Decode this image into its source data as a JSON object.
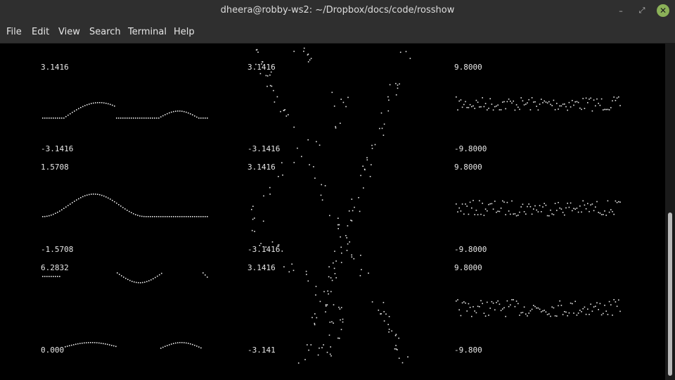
{
  "window": {
    "title": "dheera@robby-ws2: ~/Dropbox/docs/code/rosshow",
    "minimize_glyph": "–",
    "maximize_glyph": "⤢",
    "close_glyph": "✕"
  },
  "menu": [
    "File",
    "Edit",
    "View",
    "Search",
    "Terminal",
    "Help"
  ],
  "plots": [
    {
      "top": "3.1416",
      "bottom": "-3.1416"
    },
    {
      "top": "3.1416",
      "bottom": "-3.1416"
    },
    {
      "top": "9.8000",
      "bottom": "-9.8000"
    },
    {
      "top": "1.5708",
      "bottom": "-1.5708"
    },
    {
      "top": "3.1416",
      "bottom": "-3.1416"
    },
    {
      "top": "9.8000",
      "bottom": "-9.8000"
    },
    {
      "top": "6.2832",
      "bottom": "0.000"
    },
    {
      "top": "3.1416",
      "bottom": "-3.141"
    },
    {
      "top": "9.8000",
      "bottom": "-9.800"
    }
  ],
  "colors": {
    "titlebar": "#2f2f2f",
    "close_button": "#8bb158",
    "plot_dots": "#e8e8e8",
    "terminal_bg": "#000000"
  },
  "icons": [
    "minimize-icon",
    "maximize-icon",
    "close-icon"
  ]
}
